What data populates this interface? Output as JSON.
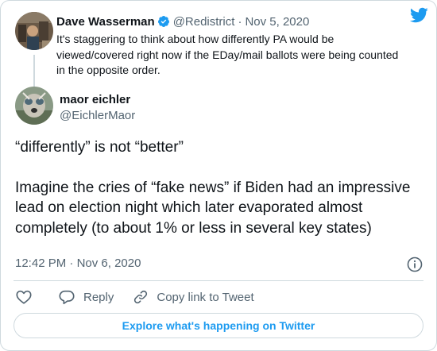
{
  "quoted_tweet": {
    "author_name": "Dave Wasserman",
    "verified_icon": "verified-badge-icon",
    "handle": "@Redistrict",
    "separator": "·",
    "date": "Nov 5, 2020",
    "text": "It's staggering to think about how differently PA would be viewed/covered right now if the EDay/mail ballots were being counted in the opposite order."
  },
  "brand_icon": "twitter-bird-icon",
  "tweet": {
    "author_name": "maor eichler",
    "handle": "@EichlerMaor",
    "paragraphs": [
      "“differently” is not “better”",
      "Imagine the cries of “fake news” if Biden had an impressive lead on election night which later evaporated almost completely (to about 1% or less in several key states)"
    ],
    "time": "12:42 PM",
    "separator": "·",
    "date": "Nov 6, 2020",
    "info_icon": "info-icon"
  },
  "actions": {
    "like_icon": "heart-icon",
    "reply_label": "Reply",
    "copy_label": "Copy link to Tweet"
  },
  "explore_label": "Explore what's happening on Twitter",
  "colors": {
    "accent": "#1d9bf0",
    "text": "#0f1419",
    "muted": "#536471",
    "border": "#cfd9de"
  }
}
